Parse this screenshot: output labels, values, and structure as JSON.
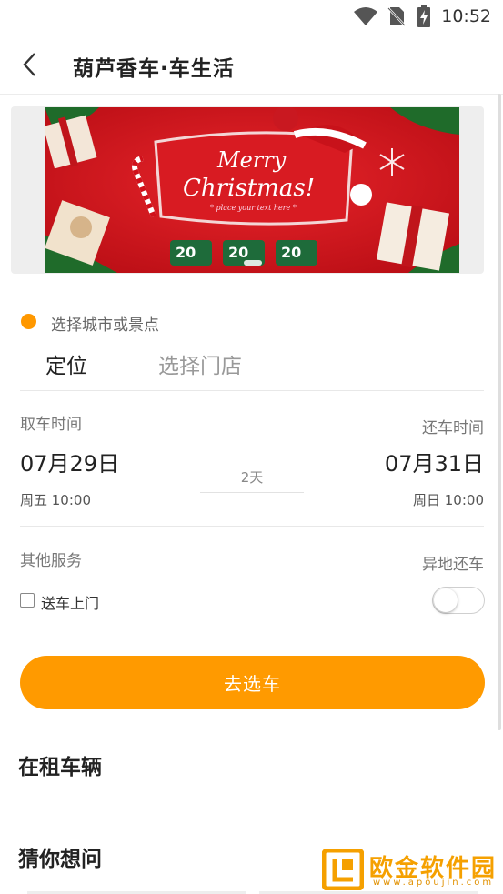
{
  "status_bar": {
    "time": "10:52"
  },
  "header": {
    "title": "葫芦香车·车生活"
  },
  "banner": {
    "line1": "Merry",
    "line2": "Christmas!",
    "line3": "* place your text here *",
    "badges": [
      "20",
      "20",
      "20"
    ]
  },
  "location": {
    "hint": "选择城市或景点",
    "locate": "定位",
    "store": "选择门店"
  },
  "pickup": {
    "label": "取车时间",
    "date": "07月29日",
    "weekday_time": "周五 10:00"
  },
  "return": {
    "label": "还车时间",
    "date": "07月31日",
    "weekday_time": "周日 10:00"
  },
  "duration": "2天",
  "services": {
    "label": "其他服务",
    "delivery": "送车上门",
    "other_return": "异地还车"
  },
  "go_button": "去选车",
  "section_rented": "在租车辆",
  "section_faq": "猜你想问",
  "watermark": {
    "name": "欧金软件园",
    "url": "www.apoujin.com"
  },
  "colors": {
    "accent": "#ff9a00",
    "banner_red": "#d8141c"
  }
}
